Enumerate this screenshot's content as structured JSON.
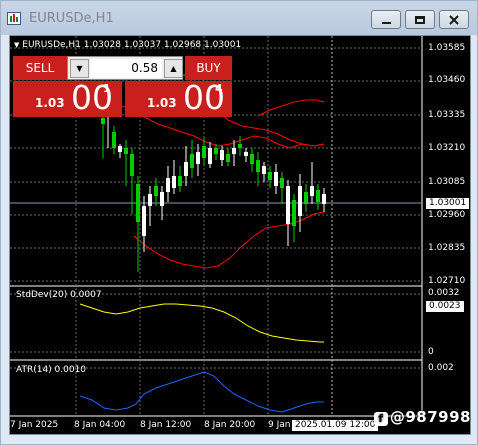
{
  "window": {
    "title": "EURUSDe,H1",
    "buttons": [
      "minimize",
      "restore",
      "close"
    ]
  },
  "chart": {
    "header": "EURUSDe,H1  1.03028 1.03037 1.02968 1.03001",
    "price_axis": [
      "1.03585",
      "1.03460",
      "1.03335",
      "1.03210",
      "1.03085",
      "1.02960",
      "1.02835",
      "1.02710"
    ],
    "current_price": "1.03001",
    "time_axis": [
      "7 Jan 2025",
      "8 Jan 04:00",
      "8 Jan 12:00",
      "8 Jan 20:00",
      "9 Jan"
    ],
    "crosshair_time": "2025.01.09 12:00",
    "colors": {
      "bull": "#ffffff",
      "bear": "#00cc00",
      "bands": "#ff0000",
      "stddev": "#ffff00",
      "atr": "#1e64ff",
      "grid": "#ffffff"
    }
  },
  "trade_panel": {
    "sell_label": "SELL",
    "buy_label": "BUY",
    "lot": "0.58",
    "down_arrow": "▼",
    "up_arrow": "▲",
    "bid": {
      "prefix": "1.03",
      "big": "00",
      "sup": "1"
    },
    "ask": {
      "prefix": "1.03",
      "big": "00",
      "sup": "4"
    }
  },
  "stddev": {
    "label": "StdDev(20) 0.0007",
    "axis_top": "0.0032",
    "current": "0.0023",
    "axis_bottom": "0"
  },
  "atr": {
    "label": "ATR(14) 0.0010",
    "axis_top": "0.002"
  },
  "watermark": {
    "icon": "f",
    "text": "@987998"
  }
}
